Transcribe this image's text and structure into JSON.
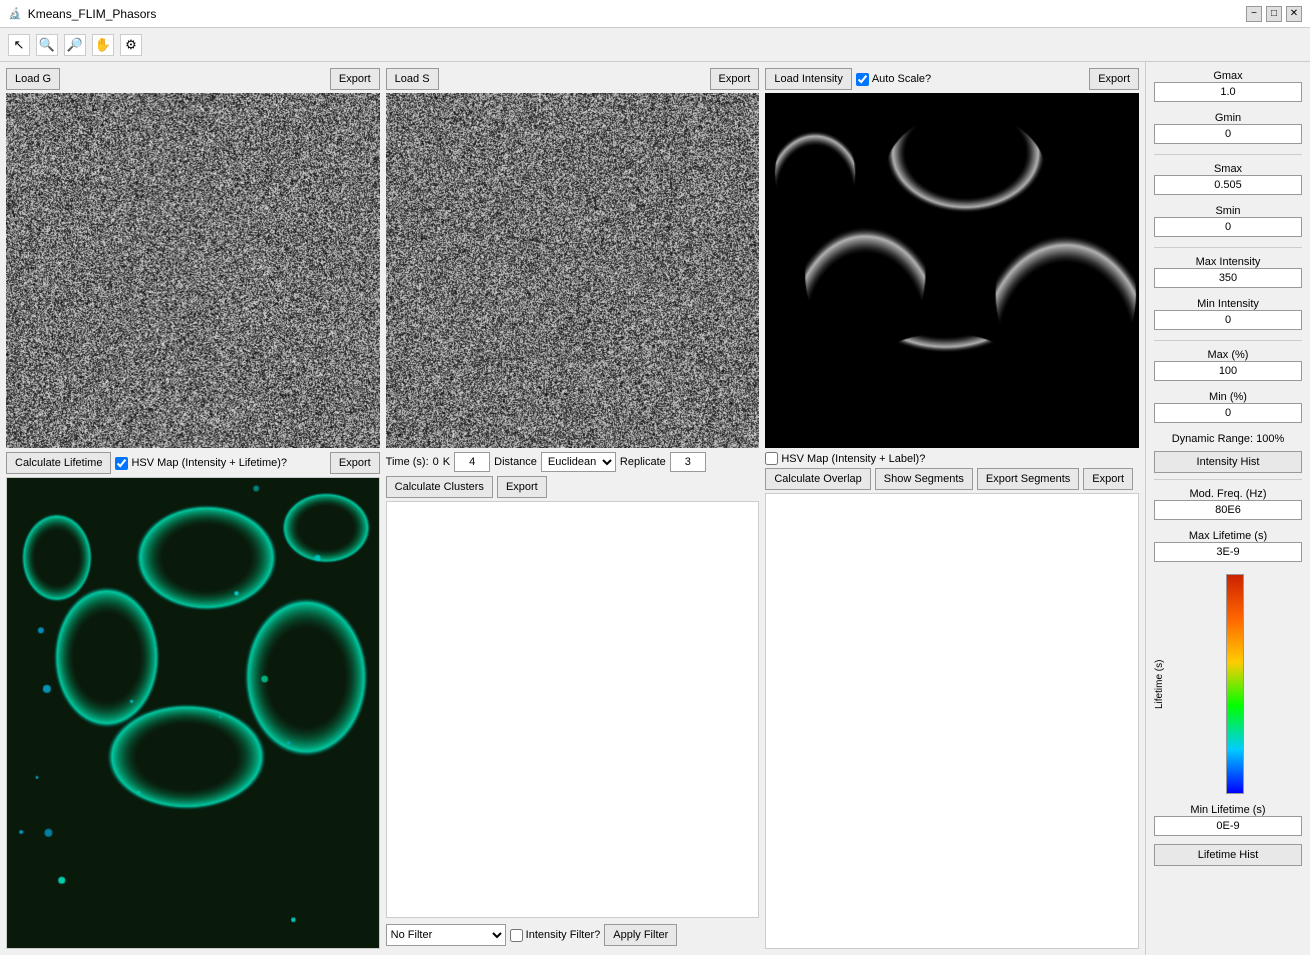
{
  "window": {
    "title": "Kmeans_FLIM_Phasors"
  },
  "toolbar": {
    "icons": [
      "cursor",
      "zoom-in",
      "zoom-out",
      "pan",
      "settings"
    ]
  },
  "top_row": {
    "g_panel": {
      "load_btn": "Load G",
      "export_btn": "Export"
    },
    "s_panel": {
      "load_btn": "Load S",
      "export_btn": "Export"
    },
    "intensity_panel": {
      "load_btn": "Load Intensity",
      "auto_scale_label": "Auto Scale?",
      "auto_scale_checked": true,
      "export_btn": "Export"
    }
  },
  "sidebar": {
    "gmax_label": "Gmax",
    "gmax_value": "1.0",
    "gmin_label": "Gmin",
    "gmin_value": "0",
    "smax_label": "Smax",
    "smax_value": "0.505",
    "smin_label": "Smin",
    "smin_value": "0",
    "max_intensity_label": "Max Intensity",
    "max_intensity_value": "350",
    "min_intensity_label": "Min Intensity",
    "min_intensity_value": "0",
    "max_pct_label": "Max (%)",
    "max_pct_value": "100",
    "min_pct_label": "Min (%)",
    "min_pct_value": "0",
    "dynamic_range_label": "Dynamic Range: 100%",
    "intensity_hist_btn": "Intensity Hist",
    "mod_freq_label": "Mod. Freq. (Hz)",
    "mod_freq_value": "80E6",
    "max_lifetime_label": "Max Lifetime (s)",
    "max_lifetime_value": "3E-9",
    "lifetime_axis_label": "Lifetime (s)",
    "min_lifetime_label": "Min Lifetime (s)",
    "min_lifetime_value": "0E-9",
    "lifetime_hist_btn": "Lifetime Hist"
  },
  "bottom_row": {
    "hsv_panel": {
      "calculate_btn": "Calculate Lifetime",
      "checkbox_label": "HSV Map (Intensity + Lifetime)?",
      "checkbox_checked": true,
      "export_btn": "Export"
    },
    "cluster_panel": {
      "time_label": "Time (s):",
      "time_value": "0",
      "k_label": "K",
      "k_value": "4",
      "distance_label": "Distance",
      "distance_value": "Euclidean",
      "replicate_label": "Replicate",
      "replicate_value": "3",
      "calculate_btn": "Calculate Clusters",
      "export_btn": "Export",
      "filter_options": [
        "No Filter"
      ],
      "filter_selected": "No Filter",
      "intensity_filter_label": "Intensity Filter?",
      "intensity_filter_checked": false,
      "apply_filter_btn": "Apply Filter"
    },
    "segment_panel": {
      "checkbox_label": "HSV Map (Intensity + Label)?",
      "checkbox_checked": false,
      "calculate_overlap_btn": "Calculate Overlap",
      "show_segments_btn": "Show Segments",
      "export_segments_btn": "Export Segments",
      "export_btn": "Export"
    }
  }
}
